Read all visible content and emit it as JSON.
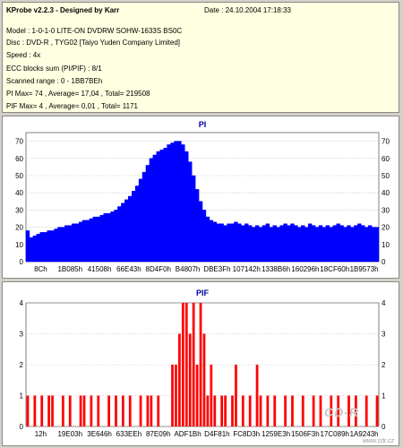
{
  "header": {
    "title": "KProbe v2.2.3 - Designed by Karr",
    "date": "Date : 24.10.2004 17:18:33",
    "model": "Model : 1-0-1-0 LITE-ON DVDRW SOHW-1633S BS0C",
    "disc": "Disc : DVD-R , TYG02 [Taiyo Yuden Company Limited]",
    "speed": "Speed : 4x",
    "ecc": "ECC blocks sum (PI/PIF) : 8/1",
    "range": "Scanned range : 0 - 1BB7BEh",
    "pi_stats": "PI Max= 74 , Average= 17,04 , Total= 219508",
    "pif_stats": "PIF Max= 4 , Average= 0,01 , Total= 1171"
  },
  "watermark": {
    "logo": "CD-R",
    "url": "www.cdr.cz"
  },
  "chart_data": [
    {
      "type": "area",
      "title": "PI",
      "xlabel": "",
      "ylabel": "",
      "x_ticks": [
        "8Ch",
        "1B085h",
        "41508h",
        "66E43h",
        "8D4F0h",
        "B4807h",
        "DBE3Fh",
        "107142h",
        "1338B6h",
        "160296h",
        "18CF60h",
        "1B9573h"
      ],
      "ylim": [
        0,
        75
      ],
      "y_ticks": [
        0,
        10,
        20,
        30,
        40,
        50,
        60,
        70
      ],
      "color": "#0000ff",
      "grid": true,
      "series": [
        {
          "values": [
            18,
            14,
            15,
            16,
            17,
            17,
            18,
            18,
            19,
            20,
            20,
            21,
            21,
            22,
            22,
            23,
            24,
            24,
            25,
            26,
            26,
            27,
            28,
            28,
            29,
            30,
            32,
            34,
            36,
            38,
            41,
            44,
            48,
            52,
            56,
            60,
            62,
            64,
            65,
            66,
            68,
            69,
            70,
            70,
            68,
            64,
            58,
            50,
            42,
            35,
            30,
            26,
            24,
            23,
            22,
            22,
            21,
            22,
            22,
            23,
            22,
            21,
            22,
            21,
            20,
            21,
            20,
            21,
            22,
            20,
            21,
            20,
            21,
            22,
            21,
            22,
            21,
            20,
            21,
            20,
            22,
            21,
            20,
            21,
            20,
            21,
            20,
            21,
            22,
            21,
            20,
            21,
            20,
            21,
            22,
            21,
            20,
            21,
            20,
            20
          ]
        }
      ]
    },
    {
      "type": "bar",
      "title": "PIF",
      "xlabel": "",
      "ylabel": "",
      "x_ticks": [
        "12h",
        "19E03h",
        "3E646h",
        "633EEh",
        "87E09h",
        "ADF1Bh",
        "D4F81h",
        "FC8D3h",
        "1259E3h",
        "1506F3h",
        "17C089h",
        "1A9243h"
      ],
      "ylim": [
        0,
        4
      ],
      "y_ticks": [
        0,
        1,
        2,
        3,
        4
      ],
      "color": "#ff0000",
      "grid": true,
      "series": [
        {
          "values": [
            1,
            0,
            1,
            0,
            1,
            0,
            1,
            1,
            0,
            0,
            1,
            0,
            1,
            0,
            0,
            1,
            1,
            0,
            1,
            0,
            1,
            0,
            0,
            1,
            0,
            1,
            0,
            1,
            0,
            1,
            0,
            0,
            1,
            0,
            1,
            1,
            0,
            1,
            0,
            0,
            0,
            2,
            2,
            3,
            4,
            4,
            3,
            4,
            2,
            4,
            3,
            1,
            2,
            1,
            0,
            1,
            1,
            0,
            1,
            2,
            0,
            1,
            0,
            1,
            0,
            2,
            1,
            0,
            1,
            0,
            1,
            0,
            0,
            1,
            0,
            1,
            0,
            0,
            1,
            0,
            0,
            1,
            0,
            1,
            0,
            0,
            1,
            0,
            1,
            0,
            0,
            1,
            0,
            1,
            0,
            0,
            1,
            0,
            0,
            1
          ]
        }
      ]
    }
  ]
}
